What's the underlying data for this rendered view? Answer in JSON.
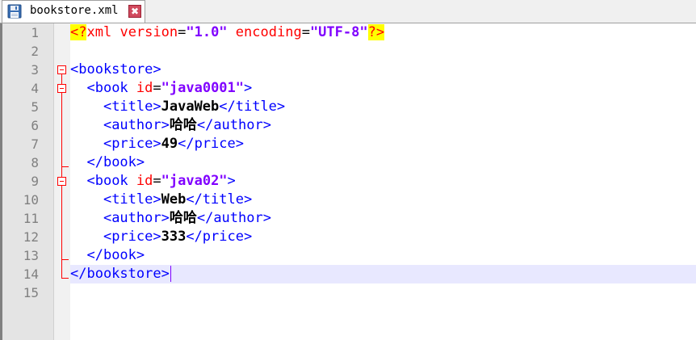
{
  "tab": {
    "filename": "bookstore.xml",
    "close_glyph": "✖"
  },
  "editor": {
    "line_numbers": [
      "1",
      "2",
      "3",
      "4",
      "5",
      "6",
      "7",
      "8",
      "9",
      "10",
      "11",
      "12",
      "13",
      "14",
      "15"
    ],
    "current_line": 14,
    "lines": {
      "l1": {
        "pi_open": "<?",
        "name": "xml",
        "sp1": " ",
        "attr1": "version",
        "eq1": "=",
        "val1": "\"1.0\"",
        "sp2": " ",
        "attr2": "encoding",
        "eq2": "=",
        "val2": "\"UTF-8\"",
        "pi_close": "?>"
      },
      "l3": {
        "open": "<bookstore>"
      },
      "l4": {
        "indent": "  ",
        "tag": "<book",
        "sp": " ",
        "attr": "id",
        "eq": "=",
        "val": "\"java0001\"",
        "close": ">"
      },
      "l5": {
        "indent": "    ",
        "open": "<title>",
        "text": "JavaWeb",
        "close": "</title>"
      },
      "l6": {
        "indent": "    ",
        "open": "<author>",
        "text": "哈哈",
        "close": "</author>"
      },
      "l7": {
        "indent": "    ",
        "open": "<price>",
        "text": "49",
        "close": "</price>"
      },
      "l8": {
        "indent": "  ",
        "close": "</book>"
      },
      "l9": {
        "indent": "  ",
        "tag": "<book",
        "sp": " ",
        "attr": "id",
        "eq": "=",
        "val": "\"java02\"",
        "close": ">"
      },
      "l10": {
        "indent": "    ",
        "open": "<title>",
        "text": "Web",
        "close": "</title>"
      },
      "l11": {
        "indent": "    ",
        "open": "<author>",
        "text": "哈哈",
        "close": "</author>"
      },
      "l12": {
        "indent": "    ",
        "open": "<price>",
        "text": "333",
        "close": "</price>"
      },
      "l13": {
        "indent": "  ",
        "close": "</book>"
      },
      "l14": {
        "close": "</bookstore>"
      }
    }
  },
  "colors": {
    "tag": "#0000ff",
    "attribute": "#ff0000",
    "attribute_value": "#8000ff",
    "pi_highlight": "#ffff00",
    "current_line_bg": "#e8e8ff",
    "fold_marker": "#ff0000"
  },
  "icons": {
    "tab_icon": "floppy-disk-icon",
    "close_icon": "close-icon",
    "fold_icon": "minus-box-icon"
  }
}
